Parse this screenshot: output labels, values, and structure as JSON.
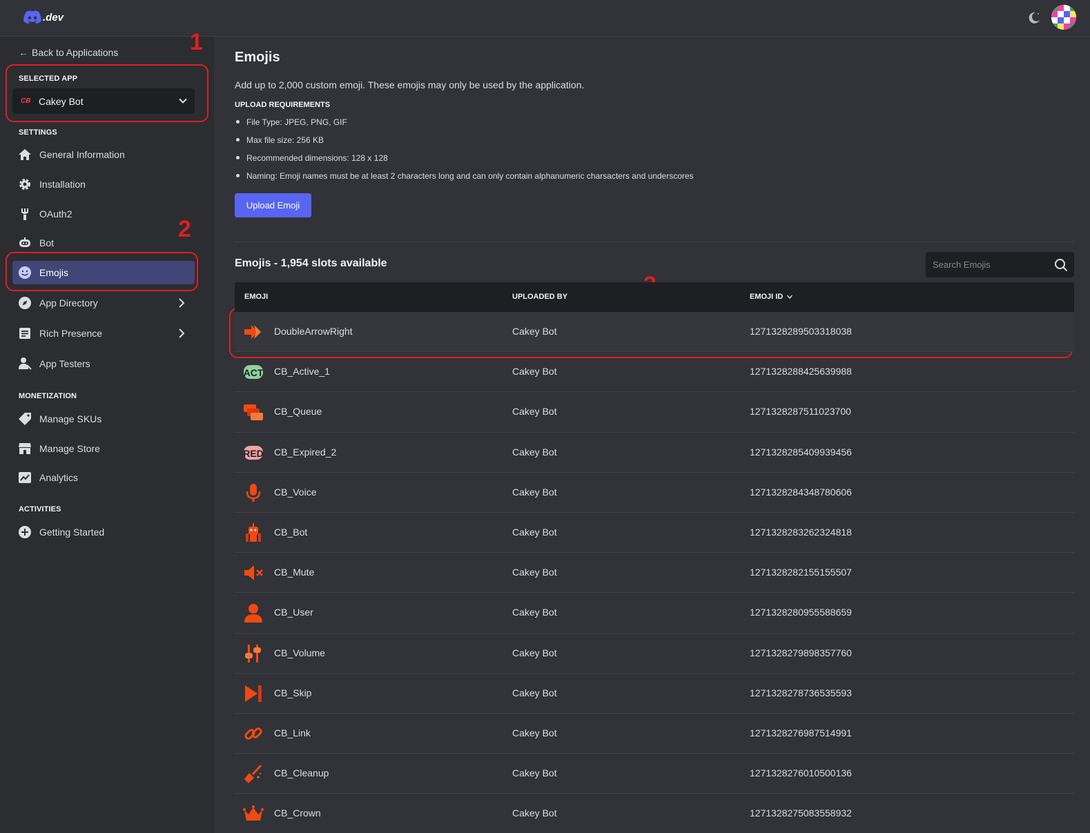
{
  "topbar": {
    "logo_text": ".dev"
  },
  "sidebar": {
    "back_label": "Back to Applications",
    "selected_app_label": "SELECTED APP",
    "selected_app_name": "Cakey Bot",
    "app_icon_text": "CB",
    "settings_label": "SETTINGS",
    "settings_items": [
      {
        "label": "General Information",
        "icon": "home-icon"
      },
      {
        "label": "Installation",
        "icon": "gear-icon"
      },
      {
        "label": "OAuth2",
        "icon": "wrench-icon"
      },
      {
        "label": "Bot",
        "icon": "bot-icon"
      },
      {
        "label": "Emojis",
        "icon": "smile-icon",
        "active": true
      },
      {
        "label": "App Directory",
        "icon": "compass-icon"
      },
      {
        "label": "Rich Presence",
        "icon": "document-icon"
      },
      {
        "label": "App Testers",
        "icon": "user-icon"
      }
    ],
    "monetization_label": "MONETIZATION",
    "monetization_items": [
      {
        "label": "Manage SKUs",
        "icon": "tag-icon"
      },
      {
        "label": "Manage Store",
        "icon": "store-icon"
      },
      {
        "label": "Analytics",
        "icon": "chart-icon"
      }
    ],
    "activities_label": "ACTIVITIES",
    "activities_items": [
      {
        "label": "Getting Started",
        "icon": "plus-circle-icon"
      }
    ]
  },
  "annotations": [
    "1",
    "2",
    "3"
  ],
  "main": {
    "title": "Emojis",
    "description": "Add up to 2,000 custom emoji. These emojis may only be used by the application.",
    "requirements_label": "UPLOAD REQUIREMENTS",
    "requirements": [
      "File Type: JPEG, PNG, GIF",
      "Max file size: 256 KB",
      "Recommended dimensions: 128 x 128",
      "Naming: Emoji names must be at least 2 characters long and can only contain alphanumeric charsacters and underscores"
    ],
    "upload_button": "Upload Emoji",
    "list_title": "Emojis - 1,954 slots available",
    "search_placeholder": "Search Emojis",
    "columns": [
      "EMOJI",
      "UPLOADED BY",
      "EMOJI ID"
    ],
    "rows": [
      {
        "name": "DoubleArrowRight",
        "uploaded_by": "Cakey Bot",
        "id": "1271328289503318038",
        "icon": "double-arrow-right-icon"
      },
      {
        "name": "CB_Active_1",
        "uploaded_by": "Cakey Bot",
        "id": "1271328288425639988",
        "icon": "act-badge-icon"
      },
      {
        "name": "CB_Queue",
        "uploaded_by": "Cakey Bot",
        "id": "1271328287511023700",
        "icon": "queue-icon"
      },
      {
        "name": "CB_Expired_2",
        "uploaded_by": "Cakey Bot",
        "id": "1271328285409939456",
        "icon": "red-badge-icon"
      },
      {
        "name": "CB_Voice",
        "uploaded_by": "Cakey Bot",
        "id": "1271328284348780606",
        "icon": "microphone-icon"
      },
      {
        "name": "CB_Bot",
        "uploaded_by": "Cakey Bot",
        "id": "1271328283262324818",
        "icon": "robot-icon"
      },
      {
        "name": "CB_Mute",
        "uploaded_by": "Cakey Bot",
        "id": "1271328282155155507",
        "icon": "speaker-mute-icon"
      },
      {
        "name": "CB_User",
        "uploaded_by": "Cakey Bot",
        "id": "1271328280955588659",
        "icon": "user-icon"
      },
      {
        "name": "CB_Volume",
        "uploaded_by": "Cakey Bot",
        "id": "1271328279898357760",
        "icon": "sliders-icon"
      },
      {
        "name": "CB_Skip",
        "uploaded_by": "Cakey Bot",
        "id": "1271328278736535593",
        "icon": "skip-icon"
      },
      {
        "name": "CB_Link",
        "uploaded_by": "Cakey Bot",
        "id": "1271328276987514991",
        "icon": "link-icon"
      },
      {
        "name": "CB_Cleanup",
        "uploaded_by": "Cakey Bot",
        "id": "1271328276010500136",
        "icon": "broom-icon"
      },
      {
        "name": "CB_Crown",
        "uploaded_by": "Cakey Bot",
        "id": "1271328275083558932",
        "icon": "crown-icon"
      }
    ]
  },
  "colors": {
    "accent": "#5865f2",
    "annotation_red": "#e01e1e",
    "emoji_orange": "#f04a12"
  }
}
